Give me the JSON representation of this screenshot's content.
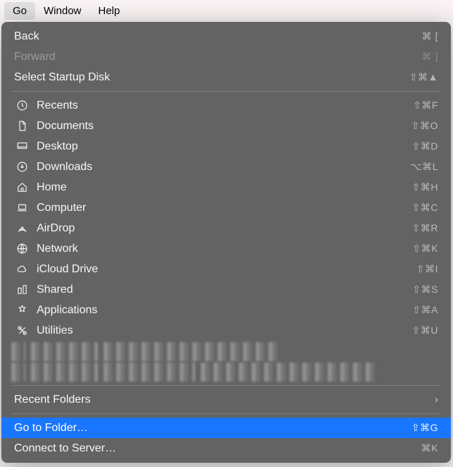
{
  "menubar": {
    "items": [
      {
        "label": "Go",
        "active": true
      },
      {
        "label": "Window",
        "active": false
      },
      {
        "label": "Help",
        "active": false
      }
    ]
  },
  "menu": {
    "nav": {
      "back": {
        "label": "Back",
        "shortcut": "⌘ ["
      },
      "forward": {
        "label": "Forward",
        "shortcut": "⌘ ]"
      },
      "select_startup": {
        "label": "Select Startup Disk",
        "shortcut": "⇧⌘▲"
      }
    },
    "locations": [
      {
        "id": "recents",
        "label": "Recents",
        "shortcut": "⇧⌘F",
        "icon": "clock"
      },
      {
        "id": "documents",
        "label": "Documents",
        "shortcut": "⇧⌘O",
        "icon": "doc"
      },
      {
        "id": "desktop",
        "label": "Desktop",
        "shortcut": "⇧⌘D",
        "icon": "desktop"
      },
      {
        "id": "downloads",
        "label": "Downloads",
        "shortcut": "⌥⌘L",
        "icon": "download"
      },
      {
        "id": "home",
        "label": "Home",
        "shortcut": "⇧⌘H",
        "icon": "home"
      },
      {
        "id": "computer",
        "label": "Computer",
        "shortcut": "⇧⌘C",
        "icon": "laptop"
      },
      {
        "id": "airdrop",
        "label": "AirDrop",
        "shortcut": "⇧⌘R",
        "icon": "airdrop"
      },
      {
        "id": "network",
        "label": "Network",
        "shortcut": "⇧⌘K",
        "icon": "globe"
      },
      {
        "id": "icloud",
        "label": "iCloud Drive",
        "shortcut": "⇧⌘I",
        "icon": "cloud"
      },
      {
        "id": "shared",
        "label": "Shared",
        "shortcut": "⇧⌘S",
        "icon": "shared"
      },
      {
        "id": "applications",
        "label": "Applications",
        "shortcut": "⇧⌘A",
        "icon": "apps"
      },
      {
        "id": "utilities",
        "label": "Utilities",
        "shortcut": "⇧⌘U",
        "icon": "utilities"
      }
    ],
    "recent_folders": {
      "label": "Recent Folders"
    },
    "go_to_folder": {
      "label": "Go to Folder…",
      "shortcut": "⇧⌘G"
    },
    "connect_server": {
      "label": "Connect to Server…",
      "shortcut": "⌘K"
    }
  }
}
